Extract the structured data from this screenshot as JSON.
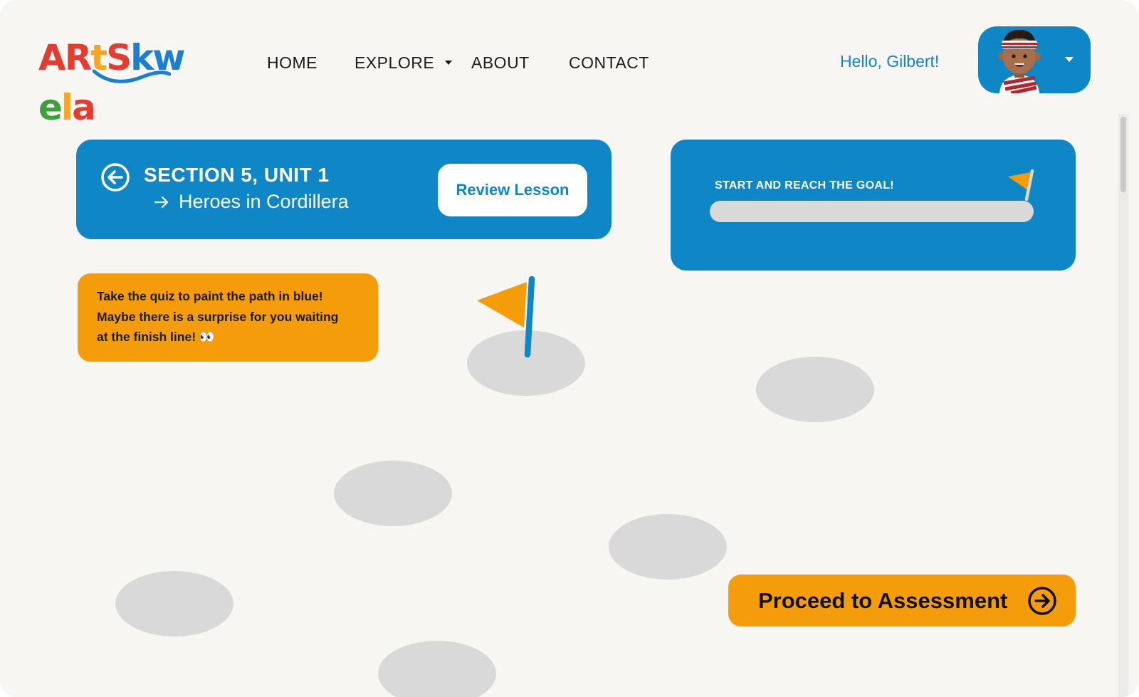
{
  "brand": {
    "logo_letters": [
      {
        "char": "A",
        "color": "#e63c2f"
      },
      {
        "char": "R",
        "color": "#e63c2f"
      },
      {
        "char": "t",
        "color": "#f5a623"
      },
      {
        "char": "S",
        "color": "#e63c2f"
      },
      {
        "char": "k",
        "color": "#1b7fd0"
      },
      {
        "char": "w",
        "color": "#1b7fd0"
      },
      {
        "char": "e",
        "color": "#3aa13b"
      },
      {
        "char": "l",
        "color": "#f5a623"
      },
      {
        "char": "a",
        "color": "#e63c2f"
      }
    ]
  },
  "nav": {
    "home": "HOME",
    "explore": "EXPLORE",
    "about": "ABOUT",
    "contact": "CONTACT"
  },
  "user": {
    "greeting": "Hello, Gilbert!"
  },
  "section": {
    "title": "SECTION 5, UNIT 1",
    "subtitle": "Heroes in Cordillera",
    "review_label": "Review Lesson"
  },
  "goal": {
    "label": "START AND REACH THE GOAL!",
    "progress": 0
  },
  "tip": {
    "line1": "Take the quiz to paint the path in blue!",
    "line2": "Maybe there is a surprise for you waiting",
    "line3": "at the finish line! 👀"
  },
  "actions": {
    "proceed_label": "Proceed to Assessment"
  },
  "colors": {
    "primary_blue": "#0f86c6",
    "accent_orange": "#f59c0a",
    "stone_gray": "#d9d9d9",
    "background": "#f7f6f3"
  }
}
